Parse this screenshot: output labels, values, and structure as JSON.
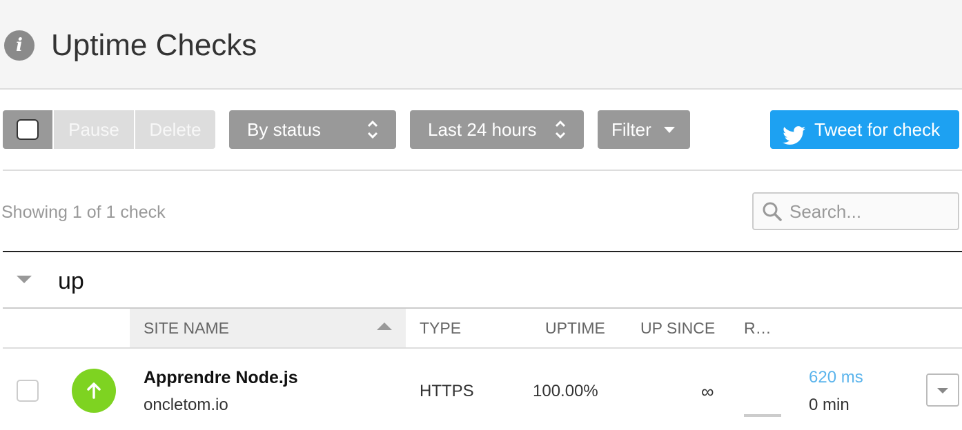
{
  "header": {
    "title": "Uptime Checks",
    "info_icon": "info-icon"
  },
  "toolbar": {
    "pause_label": "Pause",
    "delete_label": "Delete",
    "status_select": "By status",
    "range_select": "Last 24 hours",
    "filter_label": "Filter",
    "tweet_label": "Tweet for check",
    "tweet_color": "#1da1f2"
  },
  "list": {
    "showing_text": "Showing 1 of 1 check",
    "search_placeholder": "Search...",
    "group_title": "up",
    "columns": {
      "site_name": "SITE NAME",
      "type": "TYPE",
      "uptime": "UPTIME",
      "up_since": "UP SINCE",
      "response": "R…"
    },
    "rows": [
      {
        "status": "up",
        "status_color": "#7ed321",
        "site_name": "Apprendre Node.js",
        "host": "oncletom.io",
        "type": "HTTPS",
        "uptime": "100.00%",
        "up_since": "∞",
        "response_time": "620 ms",
        "downtime": "0 min"
      }
    ]
  }
}
